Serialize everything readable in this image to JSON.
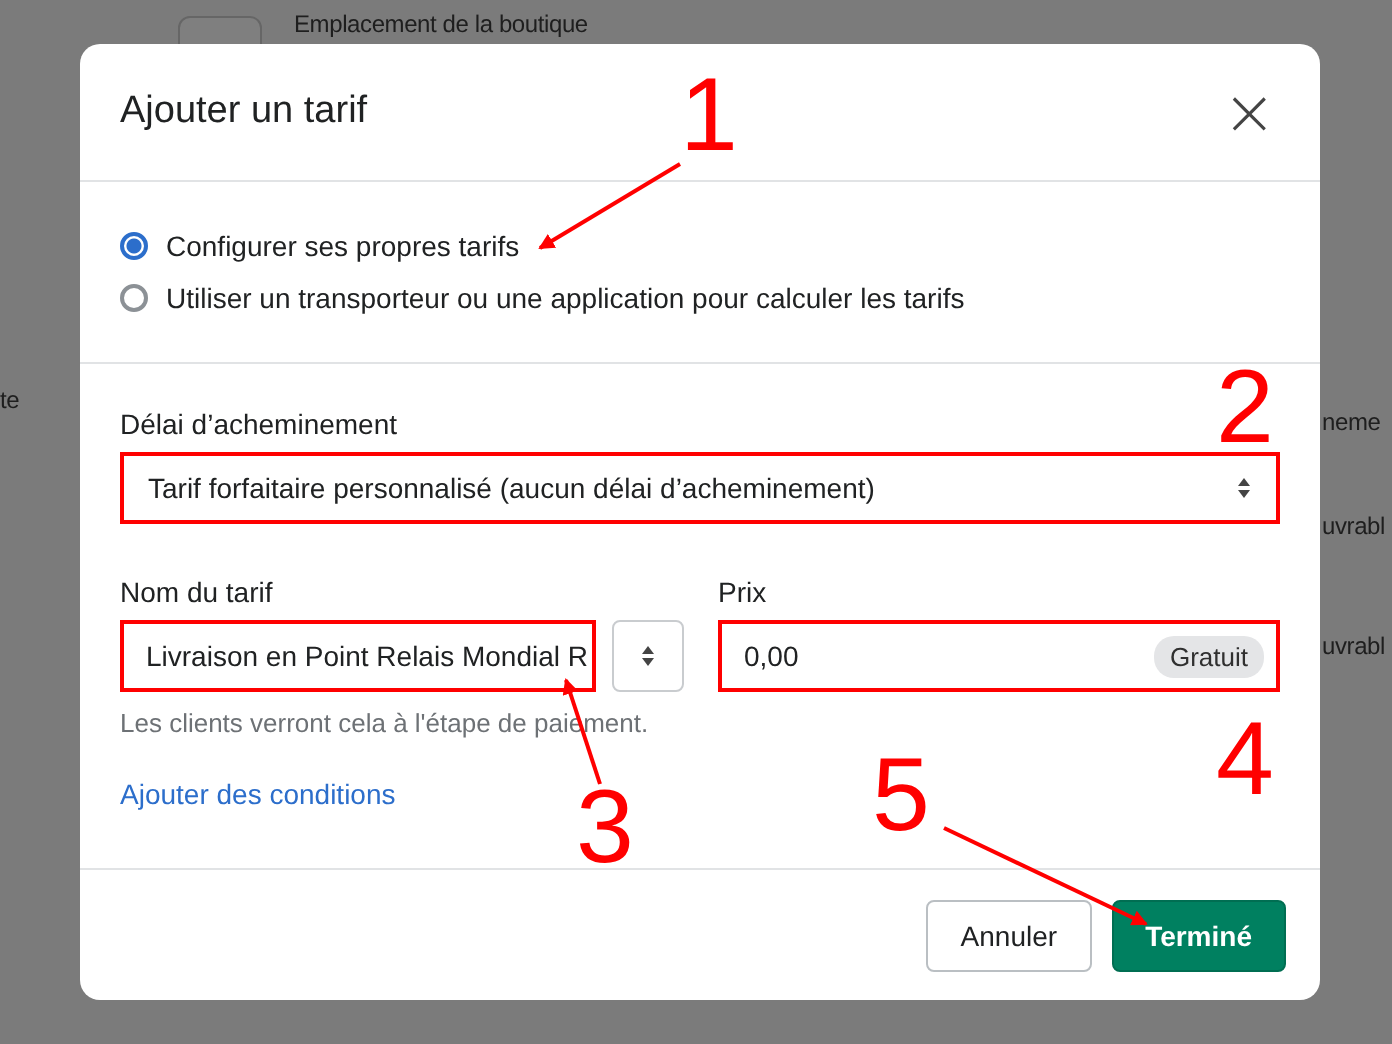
{
  "background_page": {
    "texts": [
      "Emplacement de la boutique",
      "te",
      "neme",
      "uvrabl",
      "uvrabl"
    ]
  },
  "dialog": {
    "title": "Ajouter un tarif",
    "close": "×",
    "options": [
      {
        "label": "Configurer ses propres tarifs",
        "selected": true
      },
      {
        "label": "Utiliser un transporteur ou une application pour calculer les tarifs",
        "selected": false
      }
    ],
    "delivery": {
      "label": "Délai d’acheminement",
      "value": "Tarif forfaitaire personnalisé (aucun délai d’acheminement)",
      "highlighted": true
    },
    "rate_name": {
      "label": "Nom du tarif",
      "value": "Livraison en Point Relais Mondial R",
      "highlighted": true,
      "help": "Les clients verront cela à l'étape de paiement."
    },
    "price": {
      "label": "Prix",
      "value": "0,00",
      "badge": "Gratuit",
      "highlighted": true
    },
    "link": "Ajouter des conditions",
    "buttons": [
      {
        "label": "Annuler",
        "kind": "secondary"
      },
      {
        "label": "Terminé",
        "kind": "primary"
      }
    ]
  },
  "annotations": [
    {
      "label": "1"
    },
    {
      "label": "2"
    },
    {
      "label": "3"
    },
    {
      "label": "4"
    },
    {
      "label": "5"
    }
  ]
}
